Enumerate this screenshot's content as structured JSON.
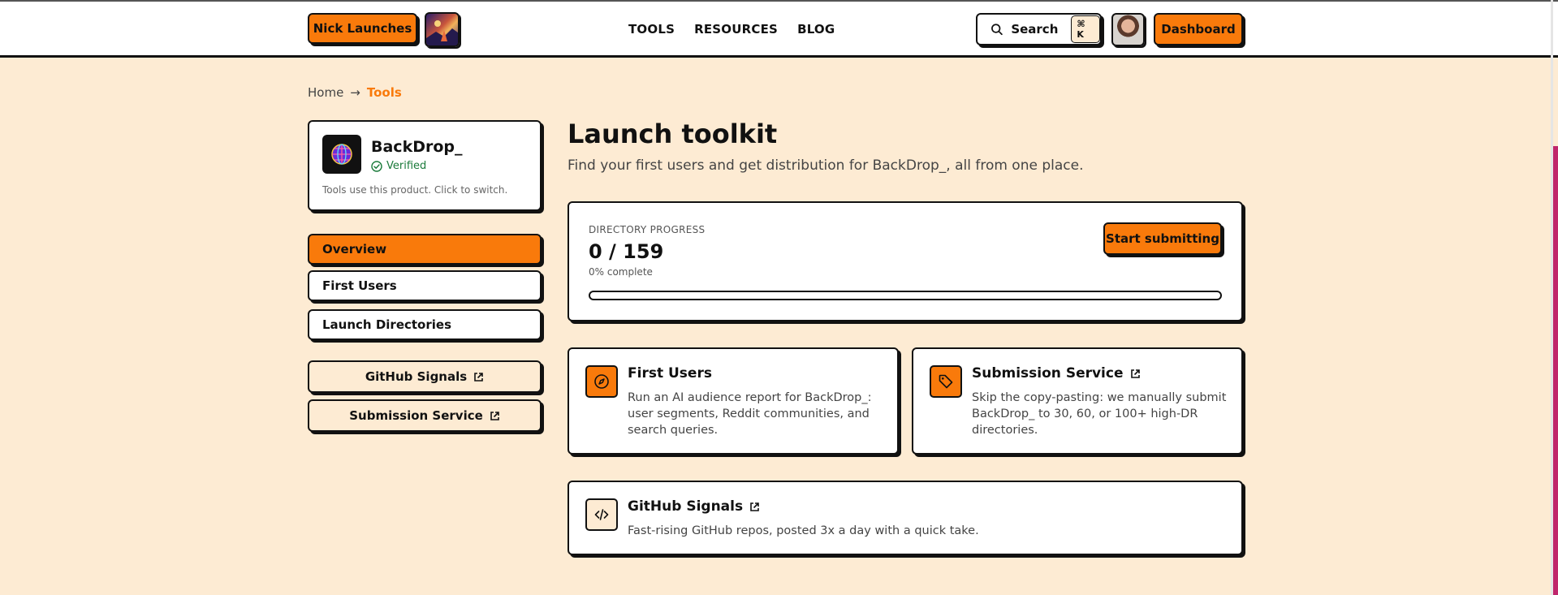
{
  "header": {
    "brand_label": "Nick Launches",
    "nav": [
      "TOOLS",
      "RESOURCES",
      "BLOG"
    ],
    "search_label": "Search",
    "search_shortcut": "⌘ K",
    "dashboard_label": "Dashboard"
  },
  "breadcrumb": {
    "home": "Home",
    "arrow": "→",
    "current": "Tools"
  },
  "product": {
    "name": "BackDrop_",
    "verified_label": "Verified",
    "hint": "Tools use this product. Click to switch."
  },
  "sidebar": {
    "items": [
      {
        "label": "Overview",
        "active": true
      },
      {
        "label": "First Users"
      },
      {
        "label": "Launch Directories"
      }
    ],
    "external": [
      {
        "label": "GitHub Signals"
      },
      {
        "label": "Submission Service"
      }
    ]
  },
  "main": {
    "title": "Launch toolkit",
    "subtitle": "Find your first users and get distribution for BackDrop_, all from one place.",
    "progress": {
      "label": "DIRECTORY PROGRESS",
      "count": "0 / 159",
      "percent_label": "0% complete",
      "value": 0,
      "button": "Start submitting"
    },
    "tools": [
      {
        "title": "First Users",
        "description": "Run an AI audience report for BackDrop_: user segments, Reddit communities, and search queries.",
        "icon": "compass-icon"
      },
      {
        "title": "Submission Service",
        "description": "Skip the copy-pasting: we manually submit BackDrop_ to 30, 60, or 100+ high-DR directories.",
        "icon": "tag-icon"
      },
      {
        "title": "GitHub Signals",
        "description": "Fast-rising GitHub repos, posted 3x a day with a quick take.",
        "icon": "code-icon"
      }
    ]
  },
  "colors": {
    "accent": "#f97a0b",
    "background": "#fdebd3",
    "verified": "#1a7a3a"
  }
}
